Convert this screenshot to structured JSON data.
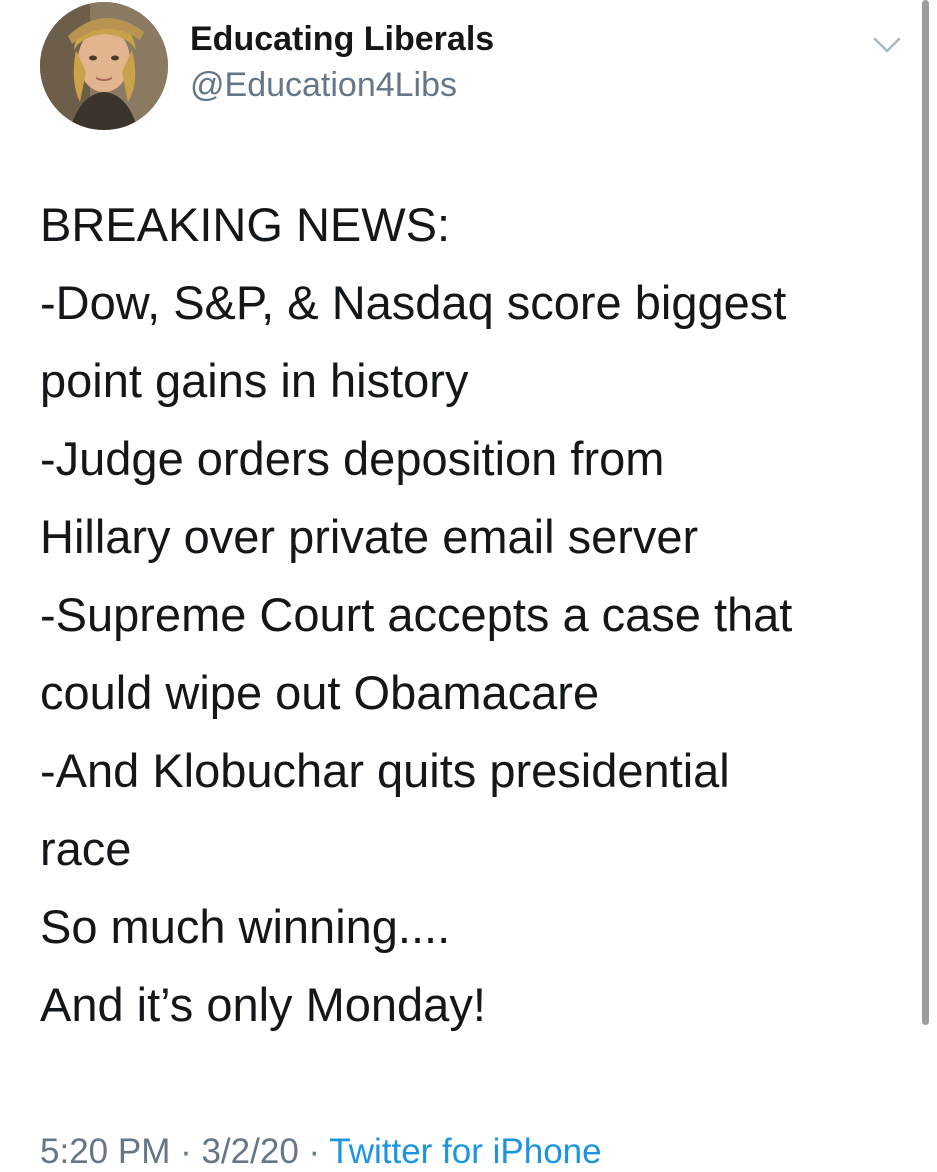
{
  "tweet": {
    "author": {
      "display_name": "Educating Liberals",
      "handle": "@Education4Libs"
    },
    "lines": [
      "BREAKING NEWS:",
      "-Dow, S&P, & Nasdaq score biggest",
      "point gains in history",
      "-Judge orders deposition from",
      "Hillary over private email server",
      "-Supreme Court accepts a case that",
      "could wipe out Obamacare",
      "-And Klobuchar quits presidential",
      "race",
      "So much winning....",
      "And it’s only Monday!"
    ],
    "meta": {
      "time": "5:20 PM",
      "separator_1": " · ",
      "date": "3/2/20",
      "separator_2": " · ",
      "source": "Twitter for iPhone"
    }
  },
  "icons": {
    "menu": "chevron-down-icon"
  },
  "colors": {
    "text": "#14171a",
    "secondary": "#657786",
    "link": "#1b95e0"
  }
}
